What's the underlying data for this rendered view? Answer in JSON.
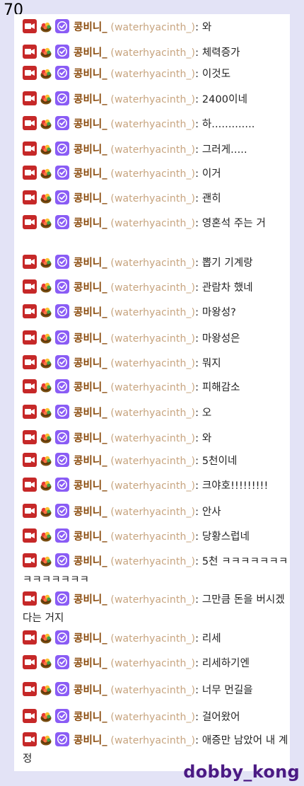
{
  "page_number": "70",
  "watermark": "dobby_kong",
  "user": {
    "nickname": "콩비니_",
    "login": "(waterhyacinth_)",
    "separator": ": "
  },
  "badges": [
    "camera-icon",
    "fruit-basket-icon",
    "verified-check-icon"
  ],
  "colors": {
    "background": "#e3e3f6",
    "panel": "#ffffff",
    "nickname": "#8a4a0b",
    "login": "#c7a47f",
    "watermark": "#4b1a84",
    "camera_badge": "#c62828",
    "verified_badge": "#8a5cf5"
  },
  "messages": [
    {
      "text": "와"
    },
    {
      "text": "체력증가"
    },
    {
      "text": "이것도"
    },
    {
      "text": "2400이네"
    },
    {
      "text": "하............."
    },
    {
      "text": "그러게....."
    },
    {
      "text": "이거"
    },
    {
      "text": "괜히"
    },
    {
      "text": "영혼석 주는 거"
    },
    {
      "text": "뽑기 기계랑"
    },
    {
      "text": "관람차 했네"
    },
    {
      "text": "마왕성?"
    },
    {
      "text": "마왕성은"
    },
    {
      "text": "뭐지"
    },
    {
      "text": "피해감소"
    },
    {
      "text": "오"
    },
    {
      "text": "와"
    },
    {
      "text": "5천이네"
    },
    {
      "text": "크야호!!!!!!!!!"
    },
    {
      "text": "안사"
    },
    {
      "text": "당황스럽네"
    },
    {
      "text": "5천 ㅋㅋㅋㅋㅋㅋㅋㅋㅋㅋㅋㅋㅋㅋ"
    },
    {
      "text": "그만큼 돈을 버시겠다는 거지"
    },
    {
      "text": "리세"
    },
    {
      "text": "리세하기엔"
    },
    {
      "text": "너무 먼길을"
    },
    {
      "text": "걸어왔어"
    },
    {
      "text": "애증만 남았어 내 계정"
    }
  ]
}
